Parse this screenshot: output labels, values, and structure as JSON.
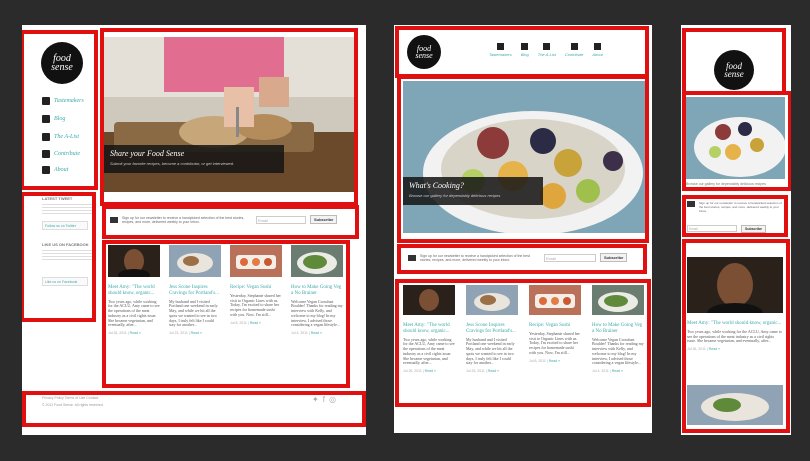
{
  "logo": {
    "line1": "food",
    "line2": "sense"
  },
  "nav": [
    "Tastemakers",
    "Blog",
    "The A-List",
    "Contribute",
    "About"
  ],
  "hero1": {
    "title": "Share your Food Sense",
    "subtitle": "Submit your favorite recipes, become a contributor, or get interviewed."
  },
  "hero2": {
    "title": "What's Cooking?",
    "subtitle": "Browse our gallery for dependably delicious recipes"
  },
  "sidebar": {
    "latest_tweet_heading": "LATEST TWEET",
    "follow_label": "Follow us on Twitter",
    "like_heading": "LIKE US ON FACEBOOK",
    "like_label": "Like us on Facebook"
  },
  "newsletter": {
    "text": "Sign up for our newsletter to receive a handpicked selection of the best stories, recipes, and more, delivered weekly to your inbox.",
    "placeholder": "Email",
    "button": "Subscribe"
  },
  "posts": [
    {
      "title": "Meet Amy: \"The world should know, organic...",
      "body": "Two years ago, while working for the ACLU, Amy came to see the operations of the meat industry as a civil rights issue. She became vegetarian, and eventually, after...",
      "date": "Jul 26, 2011 | ",
      "more": "Read »"
    },
    {
      "title": "Jess Scone Inspires Cravings for Portland's...",
      "body": "My husband and I visited Portland one weekend in early May, and while we hit all the spots we wanted to see in two days, I truly felt like I could stay for another...",
      "date": "Jul 23, 2011 | ",
      "more": "Read »"
    },
    {
      "title": "Recipe: Vegan Sushi",
      "body": "Yesterday, Stephanie shared her visit to Organic Lines with us. Today, I'm excited to share her recipes for homemade sushi with you. Now, I'm still...",
      "date": "Jul 8, 2011 | ",
      "more": "Read »"
    },
    {
      "title": "How to Make Going Veg a No Brainer",
      "body": "Welcome Vegan Crossfunt Boulder! Thanks for reading my interview with Kelly, and welcome to my blog! In my interview, I advised those considering a vegan lifestyle...",
      "date": "Jul 4, 2011 | ",
      "more": "Read »"
    }
  ],
  "footer": {
    "links": "Privacy Policy  Terms of Use  Contact",
    "copyright": "© 2011 Food Sense. All rights reserved."
  },
  "mobile_caption": "Browse our gallery for dependably delicious recipes",
  "colors": {
    "highlight": "#e01010",
    "link": "#3fa9a9",
    "background": "#2b2b2b"
  }
}
